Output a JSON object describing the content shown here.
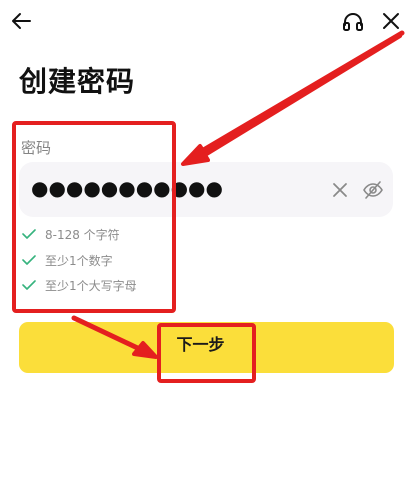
{
  "page": {
    "title": "创建密码"
  },
  "header": {
    "back_icon": "arrow-left-icon",
    "support_icon": "headset-icon",
    "close_icon": "close-icon"
  },
  "password": {
    "label": "密码",
    "masked_value": "●●●●●●●●●●●",
    "clear_icon": "clear-x-icon",
    "visibility_icon": "eye-off-icon"
  },
  "requirements": [
    {
      "text": "8-128 个字符",
      "met": true
    },
    {
      "text": "至少1个数字",
      "met": true
    },
    {
      "text": "至少1个大写字母",
      "met": true
    }
  ],
  "actions": {
    "next_label": "下一步"
  },
  "colors": {
    "accent_yellow": "#fbde3a",
    "check_green": "#36b37e",
    "annotation_red": "#e41f1f",
    "input_bg": "#f6f5f8"
  }
}
